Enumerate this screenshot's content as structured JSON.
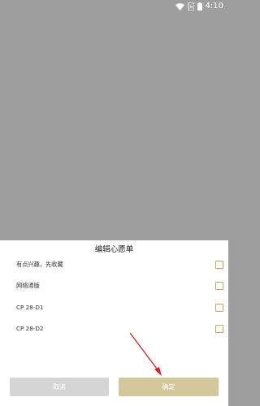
{
  "status_bar": {
    "time": "4:10",
    "icons": [
      "wifi-icon",
      "sim-icon",
      "battery-icon"
    ]
  },
  "sheet": {
    "title": "编辑心愿单",
    "options": [
      {
        "label": "有点兴趣，先收藏",
        "checked": false
      },
      {
        "label": "网络通版",
        "checked": false
      },
      {
        "label": "CP 28-D1",
        "checked": false
      },
      {
        "label": "CP 28-D2",
        "checked": false
      }
    ],
    "cancel_label": "取消",
    "confirm_label": "确定"
  },
  "colors": {
    "overlay": "#9e9e9e",
    "checkbox_border": "#c9a45f",
    "cancel_bg": "#d5d5d5",
    "confirm_bg": "#d3c89a",
    "annotation_arrow": "#e02020"
  }
}
